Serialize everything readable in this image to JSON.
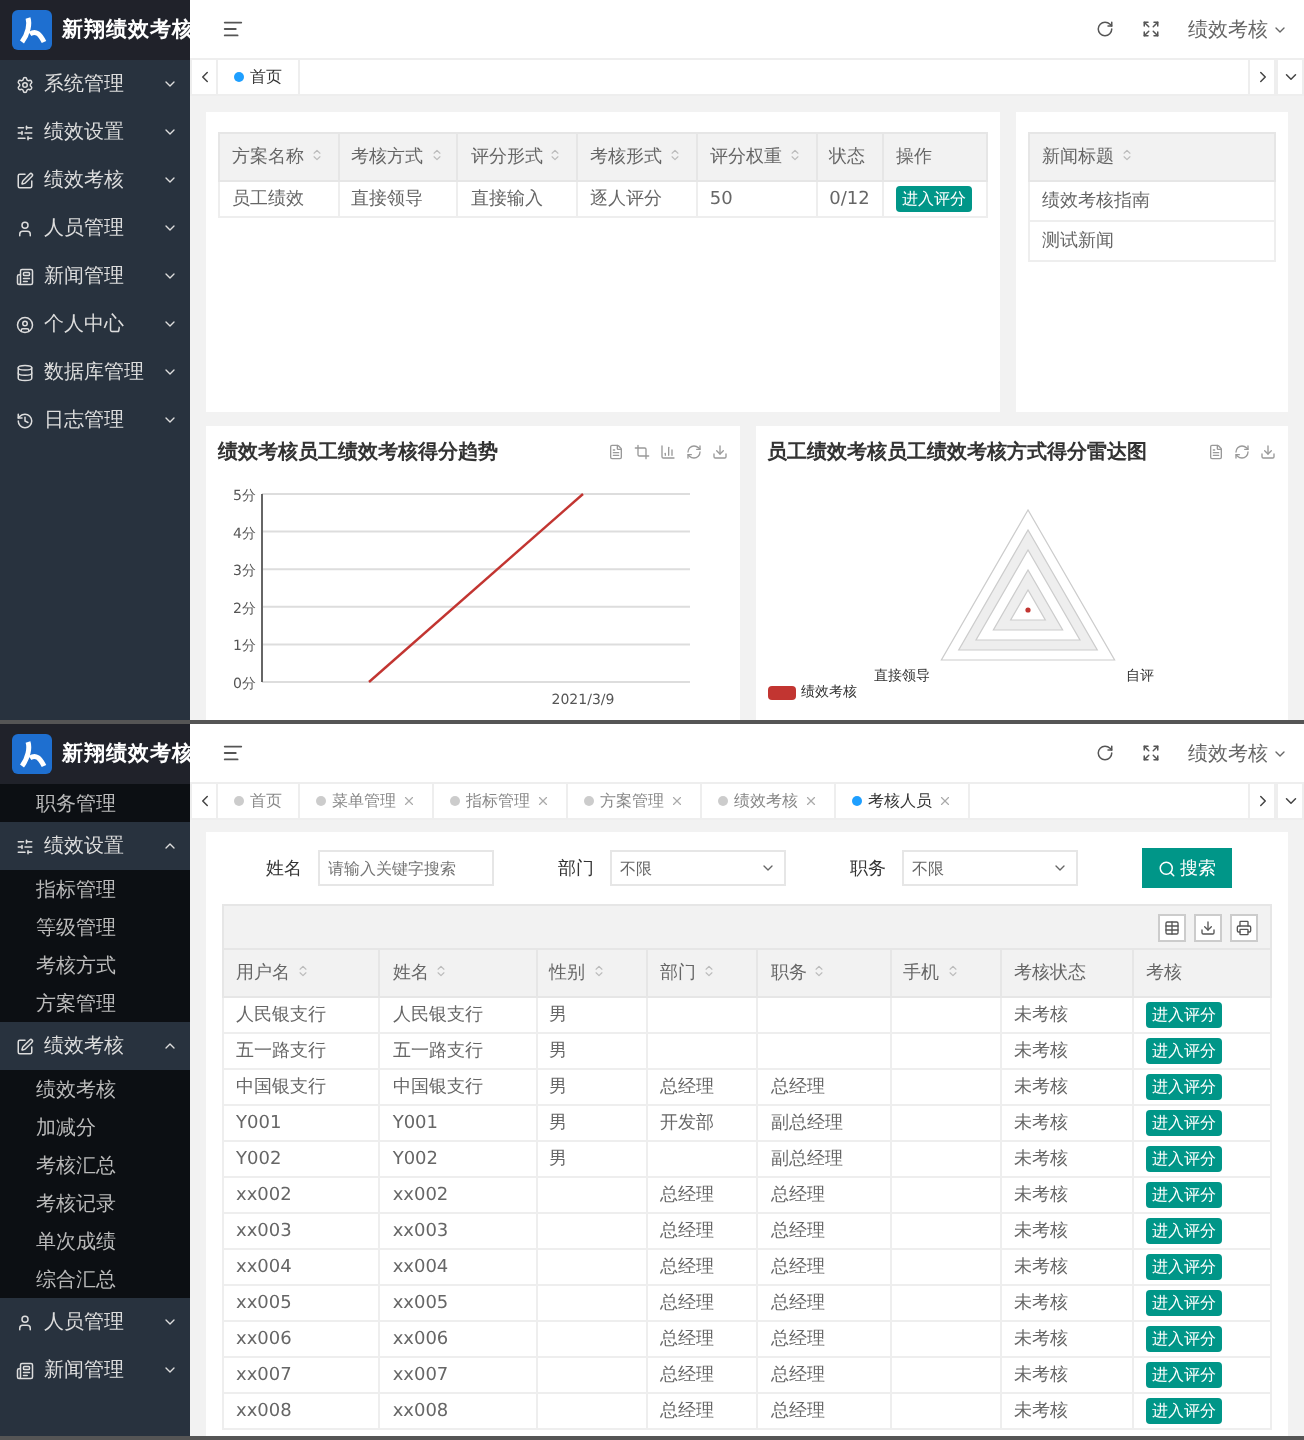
{
  "dashboard_screen": {
    "app_title": "新翔绩效考核",
    "header": {
      "user": "绩效考核"
    },
    "sidebar": {
      "items": [
        {
          "label": "系统管理",
          "kind": "group",
          "expanded": false
        },
        {
          "label": "绩效设置",
          "kind": "group",
          "expanded": false
        },
        {
          "label": "绩效考核",
          "kind": "group",
          "expanded": false
        },
        {
          "label": "人员管理",
          "kind": "group",
          "expanded": false
        },
        {
          "label": "新闻管理",
          "kind": "group",
          "expanded": false
        },
        {
          "label": "个人中心",
          "kind": "group",
          "expanded": false
        },
        {
          "label": "数据库管理",
          "kind": "group",
          "expanded": false
        },
        {
          "label": "日志管理",
          "kind": "group",
          "expanded": false
        }
      ]
    },
    "tabs": [
      {
        "label": "首页",
        "selected": true,
        "closable": false
      }
    ],
    "plan_table": {
      "columns": [
        {
          "label": "方案名称",
          "sortable": true
        },
        {
          "label": "考核方式",
          "sortable": true
        },
        {
          "label": "评分形式",
          "sortable": true
        },
        {
          "label": "考核形式",
          "sortable": true
        },
        {
          "label": "评分权重",
          "sortable": true
        },
        {
          "label": "状态",
          "sortable": false
        },
        {
          "label": "操作",
          "sortable": false
        }
      ],
      "rows": [
        {
          "cells": [
            "员工绩效",
            "直接领导",
            "直接输入",
            "逐人评分",
            "50",
            "0/12"
          ],
          "action": "进入评分"
        }
      ]
    },
    "news_table": {
      "columns": [
        {
          "label": "新闻标题",
          "sortable": true
        }
      ],
      "rows": [
        "绩效考核指南",
        "测试新闻"
      ]
    },
    "trend_chart": {
      "title": "绩效考核员工绩效考核得分趋势",
      "chart_data": {
        "type": "line",
        "categories": [
          null,
          "2021/3/9"
        ],
        "ylim": [
          0,
          5
        ],
        "grid": true,
        "yticks": [
          {
            "value": 0,
            "label": "0分"
          },
          {
            "value": 1,
            "label": "1分"
          },
          {
            "value": 2,
            "label": "2分"
          },
          {
            "value": 3,
            "label": "3分"
          },
          {
            "value": 4,
            "label": "4分"
          },
          {
            "value": 5,
            "label": "5分"
          }
        ],
        "series": [
          {
            "color": "#c23531",
            "values": [
              0,
              5
            ]
          }
        ]
      }
    },
    "radar_chart": {
      "title": "员工绩效考核员工绩效考核方式得分雷达图",
      "axes": [
        "直接领导",
        "自评"
      ],
      "legend": {
        "label": "绩效考核",
        "color": "#c23531"
      }
    }
  },
  "staff_screen": {
    "app_title": "新翔绩效考核",
    "header": {
      "user": "绩效考核"
    },
    "sidebar": {
      "items": [
        {
          "label": "职务管理",
          "kind": "sub"
        },
        {
          "label": "绩效设置",
          "kind": "group",
          "expanded": true,
          "children": [
            "指标管理",
            "等级管理",
            "考核方式",
            "方案管理"
          ]
        },
        {
          "label": "绩效考核",
          "kind": "group",
          "expanded": true,
          "children": [
            "绩效考核",
            "加减分",
            "考核汇总",
            "考核记录",
            "单次成绩",
            "综合汇总"
          ]
        },
        {
          "label": "人员管理",
          "kind": "group",
          "expanded": false
        },
        {
          "label": "新闻管理",
          "kind": "group",
          "expanded": false
        }
      ]
    },
    "tabs": [
      {
        "label": "首页",
        "selected": false,
        "closable": false
      },
      {
        "label": "菜单管理",
        "selected": false,
        "closable": true
      },
      {
        "label": "指标管理",
        "selected": false,
        "closable": true
      },
      {
        "label": "方案管理",
        "selected": false,
        "closable": true
      },
      {
        "label": "绩效考核",
        "selected": false,
        "closable": true
      },
      {
        "label": "考核人员",
        "selected": true,
        "closable": true
      }
    ],
    "filters": [
      {
        "label": "姓名",
        "kind": "input",
        "placeholder": "请输入关键字搜索"
      },
      {
        "label": "部门",
        "kind": "select",
        "value": "不限"
      },
      {
        "label": "职务",
        "kind": "select",
        "value": "不限"
      }
    ],
    "search_button": "搜索",
    "staff_table": {
      "columns": [
        {
          "label": "用户名",
          "sortable": true
        },
        {
          "label": "姓名",
          "sortable": true
        },
        {
          "label": "性别",
          "sortable": true
        },
        {
          "label": "部门",
          "sortable": true
        },
        {
          "label": "职务",
          "sortable": true
        },
        {
          "label": "手机",
          "sortable": true
        },
        {
          "label": "考核状态",
          "sortable": false
        },
        {
          "label": "考核",
          "sortable": false
        }
      ],
      "rows": [
        {
          "username": "人民银支行",
          "name": "人民银支行",
          "gender": "男",
          "status": "未考核",
          "action": "进入评分"
        },
        {
          "username": "五一路支行",
          "name": "五一路支行",
          "gender": "男",
          "status": "未考核",
          "action": "进入评分"
        },
        {
          "username": "中国银支行",
          "name": "中国银支行",
          "gender": "男",
          "department": "总经理",
          "position": "总经理",
          "status": "未考核",
          "action": "进入评分"
        },
        {
          "username": "Y001",
          "name": "Y001",
          "gender": "男",
          "department": "开发部",
          "position": "副总经理",
          "status": "未考核",
          "action": "进入评分"
        },
        {
          "username": "Y002",
          "name": "Y002",
          "gender": "男",
          "position": "副总经理",
          "status": "未考核",
          "action": "进入评分"
        },
        {
          "username": "xx002",
          "name": "xx002",
          "department": "总经理",
          "position": "总经理",
          "status": "未考核",
          "action": "进入评分"
        },
        {
          "username": "xx003",
          "name": "xx003",
          "department": "总经理",
          "position": "总经理",
          "status": "未考核",
          "action": "进入评分"
        },
        {
          "username": "xx004",
          "name": "xx004",
          "department": "总经理",
          "position": "总经理",
          "status": "未考核",
          "action": "进入评分"
        },
        {
          "username": "xx005",
          "name": "xx005",
          "department": "总经理",
          "position": "总经理",
          "status": "未考核",
          "action": "进入评分"
        },
        {
          "username": "xx006",
          "name": "xx006",
          "department": "总经理",
          "position": "总经理",
          "status": "未考核",
          "action": "进入评分"
        },
        {
          "username": "xx007",
          "name": "xx007",
          "department": "总经理",
          "position": "总经理",
          "status": "未考核",
          "action": "进入评分"
        },
        {
          "username": "xx008",
          "name": "xx008",
          "department": "总经理",
          "position": "总经理",
          "status": "未考核",
          "action": "进入评分"
        }
      ]
    }
  }
}
